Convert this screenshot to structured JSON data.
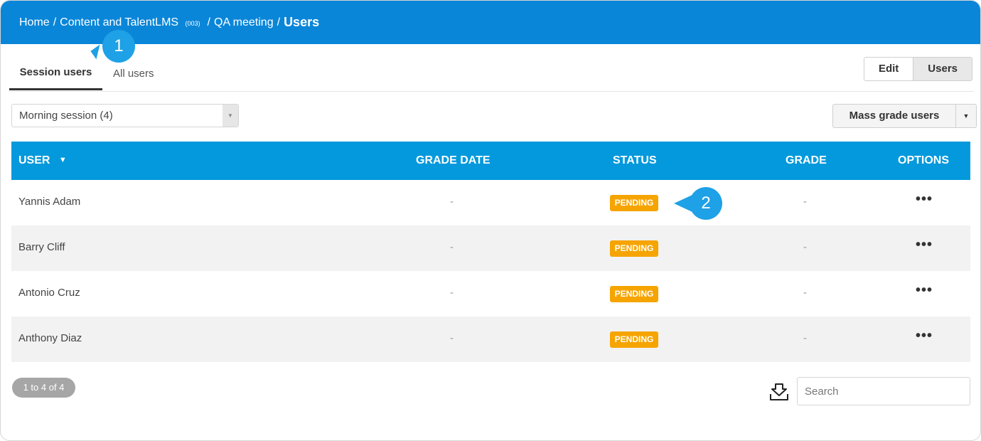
{
  "breadcrumb": {
    "home": "Home",
    "sep": "/",
    "course": "Content and TalentLMS",
    "course_code": "(003)",
    "unit": "QA meeting",
    "current": "Users"
  },
  "tabs": [
    {
      "label": "Session users",
      "active": true
    },
    {
      "label": "All users",
      "active": false
    }
  ],
  "view_toggle": {
    "edit_label": "Edit",
    "users_label": "Users"
  },
  "session_select": {
    "value": "Morning session (4)"
  },
  "mass_grade": {
    "label": "Mass grade users"
  },
  "table": {
    "headers": {
      "user": "USER",
      "grade_date": "GRADE DATE",
      "status": "STATUS",
      "grade": "GRADE",
      "options": "OPTIONS"
    },
    "rows": [
      {
        "user": "Yannis Adam",
        "grade_date": "-",
        "status": "PENDING",
        "grade": "-",
        "options": "•••"
      },
      {
        "user": "Barry Cliff",
        "grade_date": "-",
        "status": "PENDING",
        "grade": "-",
        "options": "•••"
      },
      {
        "user": "Antonio Cruz",
        "grade_date": "-",
        "status": "PENDING",
        "grade": "-",
        "options": "•••"
      },
      {
        "user": "Anthony Diaz",
        "grade_date": "-",
        "status": "PENDING",
        "grade": "-",
        "options": "•••"
      }
    ]
  },
  "pagination": {
    "label": "1 to 4 of 4"
  },
  "search": {
    "placeholder": "Search"
  },
  "callouts": {
    "first": "1",
    "second": "2"
  },
  "icons": {
    "sort": "sort-caret-down-icon",
    "select_arrow": "chevron-down-icon",
    "mass_caret": "caret-down-icon",
    "export": "download-tray-icon",
    "options": "more-horizontal-icon"
  },
  "colors": {
    "topbar": "#0a86d8",
    "table_header": "#0399dc",
    "pending_badge": "#f6a400",
    "callout": "#1ea1e6"
  }
}
